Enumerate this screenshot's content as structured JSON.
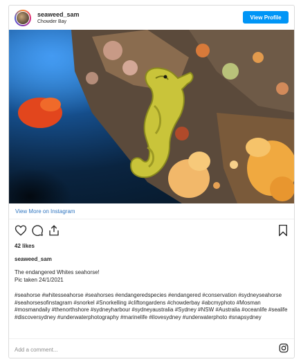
{
  "header": {
    "username": "seaweed_sam",
    "location": "Chowder Bay",
    "view_profile_label": "View Profile"
  },
  "post": {
    "image_alt": "Seahorse on coral reef",
    "view_more_label": "View More on Instagram",
    "likes": "42 likes",
    "caption_user": "seaweed_sam",
    "caption_line1": "The endangered Whites seahorse!",
    "caption_line2": "Pic taken 24/1/2021",
    "hashtags": "#seahorse #whitesseahorse #seahorses #endangeredspecies #endangered #conservation #sydneyseahorse #seahorsesofinstagram #snorkel #Snorkelling #cliftongardens #chowderbay #abcmyphoto #Mosman #mosmandaily #thenorthshore #sydneyharbour #sydneyaustralia #Sydney #NSW #Australia #oceanlife #sealife #discoversydney #underwaterphotography #marinelife #ilovesydney #underwaterphoto #snapsydney"
  },
  "comment": {
    "placeholder": "Add a comment..."
  },
  "icons": {
    "like": "heart-icon",
    "comment": "comment-icon",
    "share": "share-icon",
    "save": "bookmark-icon",
    "brand": "instagram-icon"
  },
  "colors": {
    "accent": "#0095f6",
    "link": "#2f75c0"
  }
}
